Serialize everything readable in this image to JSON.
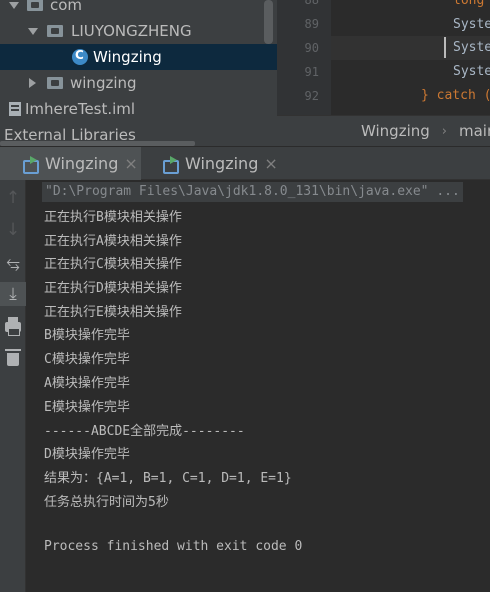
{
  "project_tree": {
    "items": [
      {
        "label": "com",
        "icon": "folder-icon",
        "expanded": true
      },
      {
        "label": "LIUYONGZHENG",
        "icon": "folder-icon",
        "expanded": true
      },
      {
        "label": "Wingzing",
        "icon": "java-class-icon",
        "selected": true
      },
      {
        "label": "wingzing",
        "icon": "folder-icon",
        "expanded": false
      },
      {
        "label": "ImhereTest.iml",
        "icon": "iml-file-icon"
      },
      {
        "label": "External Libraries",
        "icon": "library-icon"
      }
    ]
  },
  "editor": {
    "line_numbers": [
      "88",
      "89",
      "90",
      "91",
      "92",
      "93"
    ],
    "lines": [
      "long",
      "Syste",
      "Syste",
      "Syste",
      "} catch (",
      ""
    ]
  },
  "breadcrumb": {
    "items": [
      "Wingzing",
      "main"
    ],
    "separator": "›"
  },
  "run_window": {
    "tabs": [
      {
        "label": "Wingzing",
        "close": "×",
        "active": true
      },
      {
        "label": "Wingzing",
        "close": "×",
        "active": false
      }
    ],
    "toolbar_icons": [
      "up-arrow-icon",
      "down-arrow-icon",
      "soft-wrap-icon",
      "scroll-to-end-icon",
      "print-icon",
      "trash-icon"
    ],
    "command_line": "\"D:\\Program Files\\Java\\jdk1.8.0_131\\bin\\java.exe\" ...",
    "output": [
      "正在执行B模块相关操作",
      "正在执行A模块相关操作",
      "正在执行C模块相关操作",
      "正在执行D模块相关操作",
      "正在执行E模块相关操作",
      "B模块操作完毕",
      "C模块操作完毕",
      "A模块操作完毕",
      "E模块操作完毕",
      "------ABCDE全部完成--------",
      "D模块操作完毕",
      "结果为：{A=1, B=1, C=1, D=1, E=1}",
      "任务总执行时间为5秒",
      "",
      "Process finished with exit code 0"
    ]
  },
  "colors": {
    "panel": "#3c3f41",
    "editor_bg": "#2b2b2b",
    "selection": "#0d293e",
    "keyword": "#cc7832",
    "text": "#bbbbbb"
  }
}
